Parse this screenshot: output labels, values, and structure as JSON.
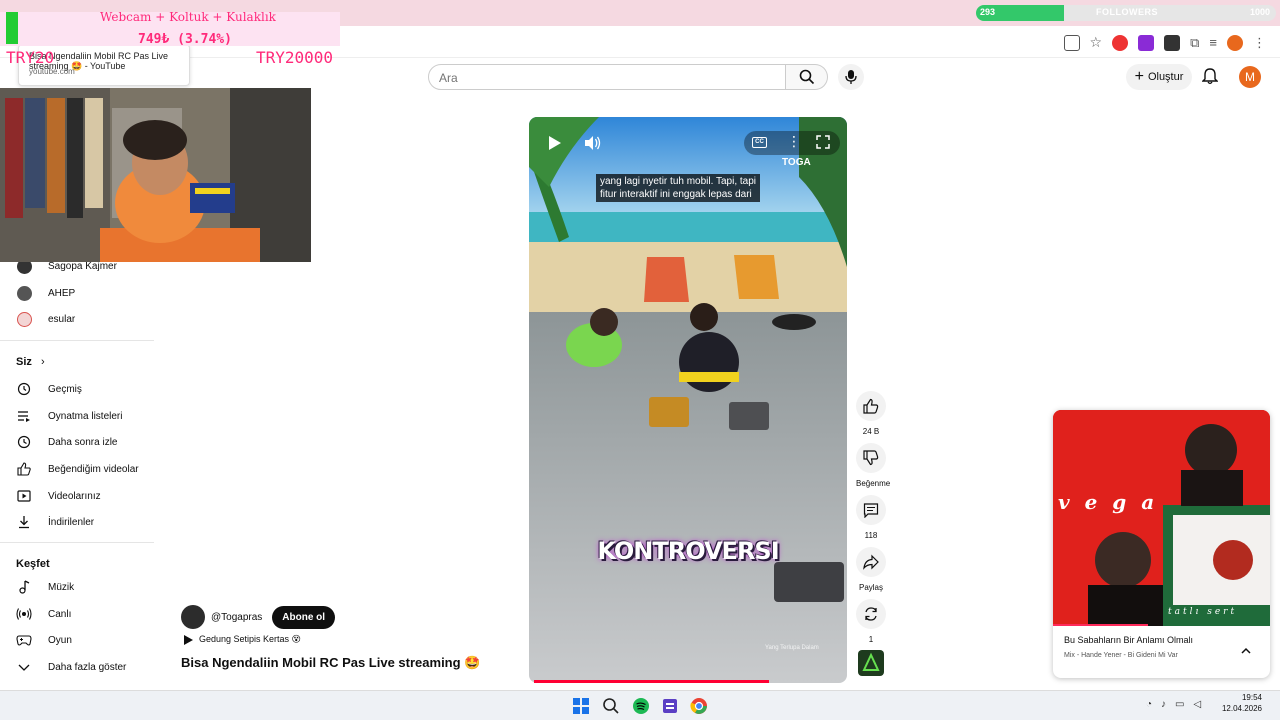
{
  "overlays": {
    "donation_headline": "Webcam + Koltuk + Kulaklık",
    "donation_amount": "749₺ (3.74%)",
    "goal_left": "TRY20",
    "goal_right": "TRY20000",
    "followers_current": "293",
    "followers_label": "FOLLOWERS",
    "followers_goal": "1000",
    "followers_fraction": 0.293
  },
  "tooltip": {
    "title": "Bisa Ngendaliin Mobil RC Pas Live streaming 🤩 - YouTube",
    "domain": "youtube.com"
  },
  "header": {
    "search_placeholder": "Ara",
    "create_label": "Oluştur",
    "avatar_letter": "M"
  },
  "sidebar": {
    "subscriptions": [
      {
        "label": "Sagopa Kajmer",
        "color": "#333333"
      },
      {
        "label": "AHEP",
        "color": "#555555"
      },
      {
        "label": "esular",
        "color": "#d9534f"
      }
    ],
    "you_heading": "Siz",
    "you_items": [
      {
        "label": "Geçmiş",
        "icon": "history-icon"
      },
      {
        "label": "Oynatma listeleri",
        "icon": "playlist-icon"
      },
      {
        "label": "Daha sonra izle",
        "icon": "clock-icon"
      },
      {
        "label": "Beğendiğim videolar",
        "icon": "like-icon"
      },
      {
        "label": "Videolarınız",
        "icon": "video-icon"
      },
      {
        "label": "İndirilenler",
        "icon": "download-icon"
      }
    ],
    "explore_heading": "Keşfet",
    "explore_items": [
      {
        "label": "Müzik",
        "icon": "music-icon"
      },
      {
        "label": "Canlı",
        "icon": "live-icon"
      },
      {
        "label": "Oyun",
        "icon": "gamepad-icon"
      },
      {
        "label": "Daha fazla göster",
        "icon": "chevron-down-icon"
      }
    ]
  },
  "video": {
    "caption": "yang lagi nyetir tuh mobil. Tapi, tapi\nfitur interaktif ini enggak lepas dari",
    "overlay_text": "KONTROVERSI",
    "logo_text": "TOGA",
    "small_text": "Yang Terlupa Dalam",
    "progress_fraction": 0.74
  },
  "info": {
    "channel": "@Togapras",
    "subscribe_label": "Abone ol",
    "audio_label": "Gedung Setipis Kertas 😵",
    "title": "Bisa Ngendaliin Mobil RC Pas Live streaming 🤩"
  },
  "actions": {
    "like_count": "24 B",
    "dislike_label": "Beğenme",
    "comment_count": "118",
    "share_label": "Paylaş",
    "remix_count": "1"
  },
  "spotify": {
    "title": "Bu Sabahların Bir Anlamı Olmalı",
    "subtitle": "Mix - Hande Yener - Bi Gideni Mi Var",
    "art_word": "v e g a",
    "art_sub": "tatlı sert"
  },
  "taskbar": {
    "time": "19:54",
    "date": "12.04.2026"
  }
}
